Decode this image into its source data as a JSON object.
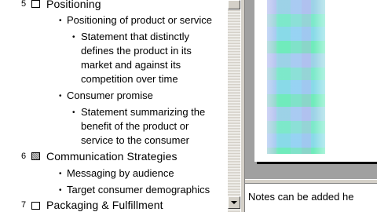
{
  "outline": {
    "slide5": {
      "number": "5",
      "title": "Positioning",
      "items": [
        {
          "text": "Positioning of product or service"
        },
        {
          "lines": [
            "Statement that distinctly",
            "defines the product in its",
            "market and against its",
            "competition over time"
          ]
        },
        {
          "text": "Consumer promise"
        },
        {
          "lines": [
            "Statement summarizing the",
            "benefit of the product or",
            "service to the consumer"
          ]
        }
      ]
    },
    "slide6": {
      "number": "6",
      "title": "Communication Strategies",
      "items": [
        "Messaging by audience",
        "Target consumer demographics"
      ]
    },
    "slide7": {
      "number": "7",
      "title": "Packaging & Fulfillment"
    },
    "bullet_glyph": "•"
  },
  "notes": {
    "text": "Notes can be added he"
  },
  "icons": {
    "slide_icon": "slide-icon",
    "scroll_down": "chevron-down-icon"
  }
}
